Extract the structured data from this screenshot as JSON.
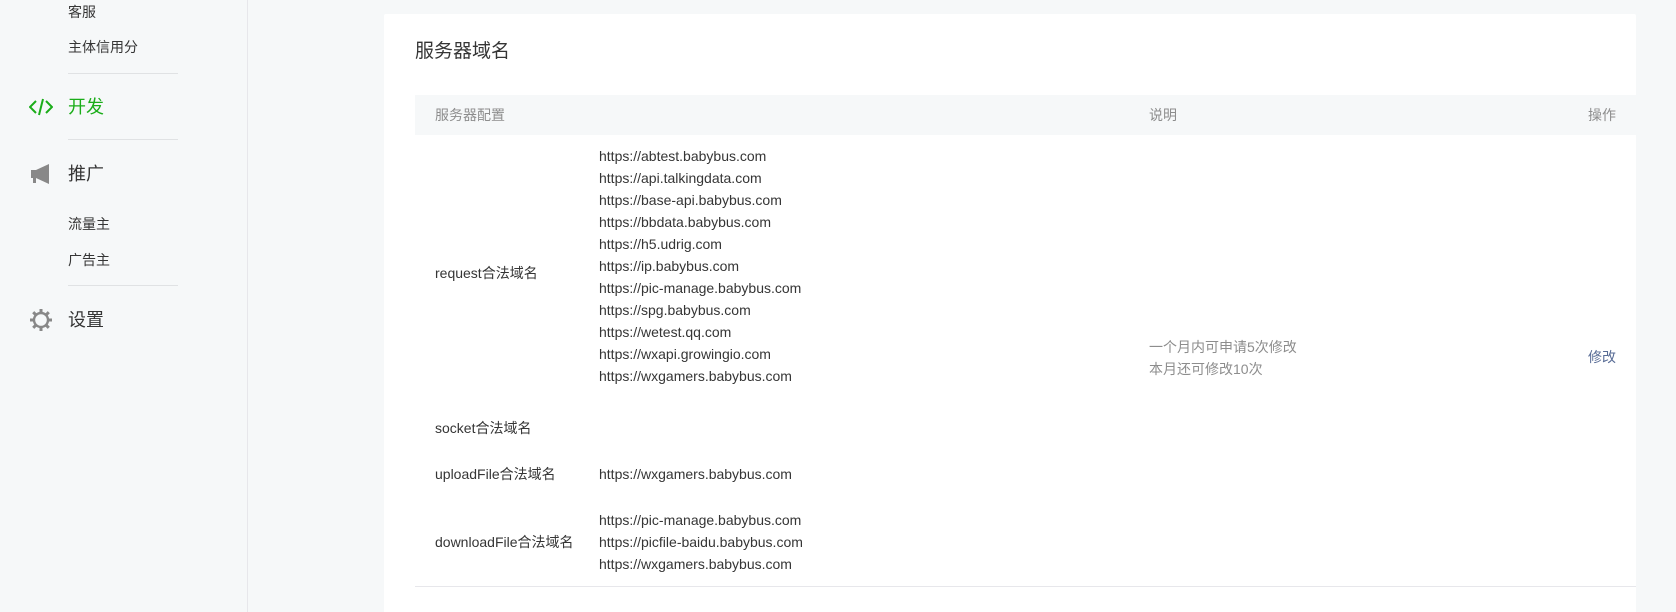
{
  "sidebar": {
    "sub_items_top": [
      {
        "label": "客服"
      },
      {
        "label": "主体信用分"
      }
    ],
    "nav": [
      {
        "label": "开发",
        "icon": "code-icon",
        "active": true
      },
      {
        "label": "推广",
        "icon": "megaphone-icon",
        "active": false
      },
      {
        "label": "设置",
        "icon": "gear-icon",
        "active": false
      }
    ],
    "promo_sub_items": [
      {
        "label": "流量主"
      },
      {
        "label": "广告主"
      }
    ]
  },
  "colors": {
    "active": "#1aad19",
    "link": "#576b95",
    "muted": "#8d8d8d",
    "text": "#353535",
    "icon": "#888888"
  },
  "card": {
    "title": "服务器域名",
    "table": {
      "headers": {
        "config": "服务器配置",
        "desc": "说明",
        "op": "操作"
      },
      "rows": [
        {
          "label": "request合法域名",
          "domains": [
            "https://abtest.babybus.com",
            "https://api.talkingdata.com",
            "https://base-api.babybus.com",
            "https://bbdata.babybus.com",
            "https://h5.udrig.com",
            "https://ip.babybus.com",
            "https://pic-manage.babybus.com",
            "https://spg.babybus.com",
            "https://wetest.qq.com",
            "https://wxapi.growingio.com",
            "https://wxgamers.babybus.com"
          ]
        },
        {
          "label": "socket合法域名",
          "domains": []
        },
        {
          "label": "uploadFile合法域名",
          "domains": [
            "https://wxgamers.babybus.com"
          ]
        },
        {
          "label": "downloadFile合法域名",
          "domains": [
            "https://pic-manage.babybus.com",
            "https://picfile-baidu.babybus.com",
            "https://wxgamers.babybus.com"
          ]
        }
      ],
      "note_lines": [
        "一个月内可申请5次修改",
        "本月还可修改10次"
      ],
      "action_label": "修改"
    }
  }
}
